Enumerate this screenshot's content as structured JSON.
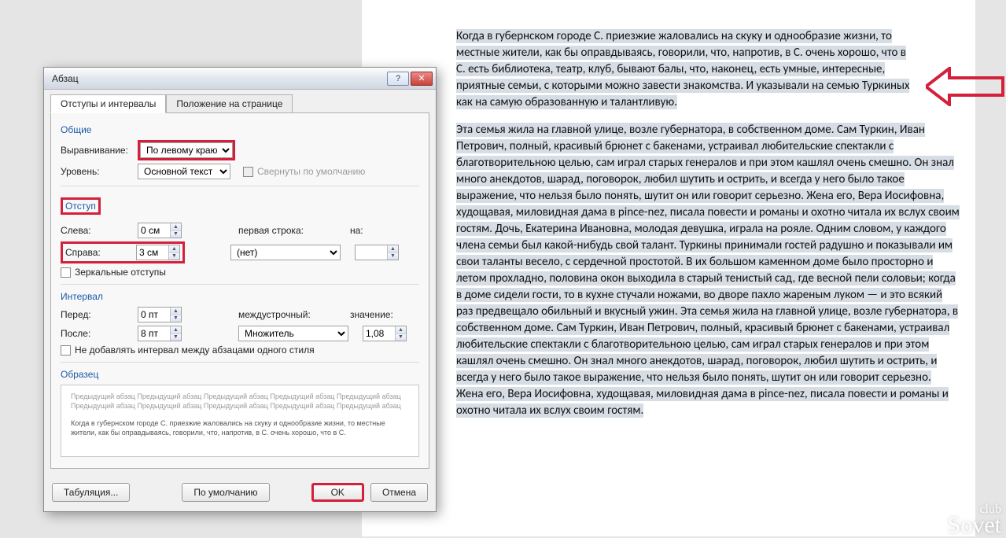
{
  "document": {
    "para1": "Когда в губернском городе С. приезжие жаловались на скуку и однообразие жизни, то местные жители, как бы оправдываясь, говорили, что, напротив, в С. очень хорошо, что в С. есть библиотека, театр, клуб, бывают балы, что, наконец, есть умные, интересные, приятные семьи, с которыми можно завести знакомства. И указывали на семью Туркиных как на самую образованную и талантливую.",
    "para2": "Эта семья жила на главной улице, возле губернатора, в собственном доме. Сам Туркин, Иван Петрович, полный, красивый брюнет с бакенами, устраивал любительские спектакли с благотворительною целью, сам играл старых генералов и при этом кашлял очень смешно. Он знал много анекдотов, шарад, поговорок, любил шутить и острить, и всегда у него было такое выражение, что нельзя было понять, шутит он или говорит серьезно. Жена его, Вера Иосифовна, худощавая, миловидная дама в pince-nez, писала повести и романы и охотно читала их вслух своим гостям. Дочь, Екатерина Ивановна, молодая девушка, играла на рояле. Одним словом, у каждого члена семьи был какой-нибудь свой талант. Туркины принимали гостей радушно и показывали им свои таланты весело, с сердечной простотой. В их большом каменном доме было просторно и летом прохладно, половина окон выходила в старый тенистый сад, где весной пели соловьи; когда в доме сидели гости, то в кухне стучали ножами, во дворе пахло жареным луком — и это всякий раз предвещало обильный и вкусный ужин. Эта семья жила на главной улице, возле губернатора, в собственном доме. Сам Туркин, Иван Петрович, полный, красивый брюнет с бакенами, устраивал любительские спектакли с благотворительною целью, сам играл старых генералов и при этом кашлял очень смешно. Он знал много анекдотов, шарад, поговорок, любил шутить и острить, и всегда у него было такое выражение, что нельзя было понять, шутит он или говорит серьезно. Жена его, Вера Иосифовна, худощавая, миловидная дама в pince-nez, писала повести и романы и охотно читала их вслух своим гостям."
  },
  "dialog": {
    "title": "Абзац",
    "tabs": {
      "indent": "Отступы и интервалы",
      "position": "Положение на странице"
    },
    "group_general": "Общие",
    "lbl_align": "Выравнивание:",
    "align_value": "По левому краю",
    "lbl_level": "Уровень:",
    "level_value": "Основной текст",
    "chk_collapse": "Свернуты по умолчанию",
    "group_indent": "Отступ",
    "lbl_left": "Слева:",
    "val_left": "0 см",
    "lbl_right": "Справа:",
    "val_right": "3 см",
    "lbl_firstline": "первая строка:",
    "firstline_value": "(нет)",
    "lbl_by1": "на:",
    "chk_mirror": "Зеркальные отступы",
    "group_spacing": "Интервал",
    "lbl_before": "Перед:",
    "val_before": "0 пт",
    "lbl_after": "После:",
    "val_after": "8 пт",
    "lbl_linespacing": "междустрочный:",
    "linespacing_value": "Множитель",
    "lbl_by2": "значение:",
    "val_by2": "1,08",
    "chk_nospace": "Не добавлять интервал между абзацами одного стиля",
    "group_preview": "Образец",
    "preview_grey": "Предыдущий абзац Предыдущий абзац Предыдущий абзац Предыдущий абзац Предыдущий абзац Предыдущий абзац Предыдущий абзац Предыдущий абзац Предыдущий абзац Предыдущий абзац",
    "preview_sample": "Когда в губернском городе С. приезжие жаловались на скуку и однообразие жизни, то местные жители, как бы оправдываясь, говорили, что, напротив, в С. очень хорошо, что в С.",
    "btn_tabs": "Табуляция...",
    "btn_default": "По умолчанию",
    "btn_ok": "OK",
    "btn_cancel": "Отмена"
  },
  "watermark": {
    "top": "club",
    "bottom": "Sovet"
  }
}
